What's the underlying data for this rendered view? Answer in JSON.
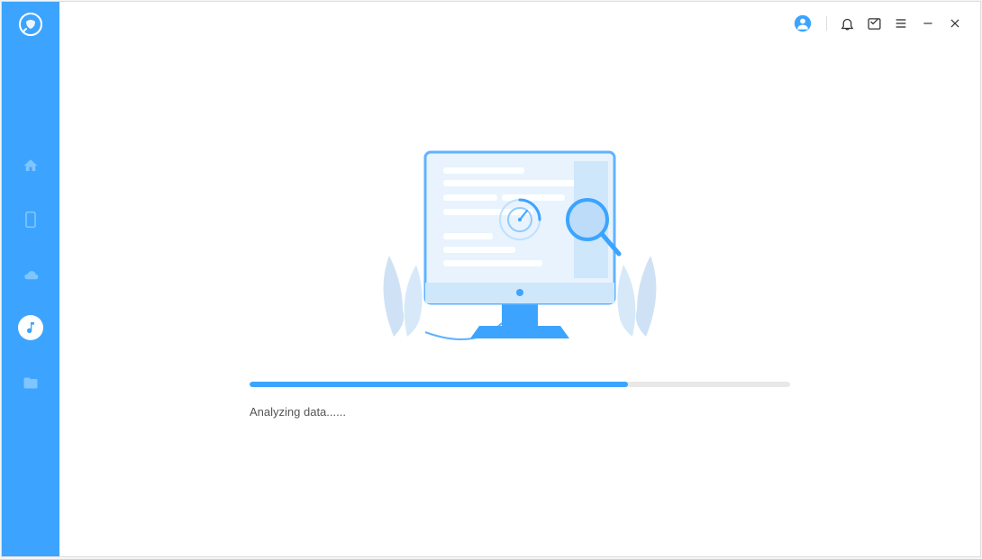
{
  "sidebar": {
    "items": [
      {
        "name": "home"
      },
      {
        "name": "phone"
      },
      {
        "name": "cloud"
      },
      {
        "name": "music",
        "active": true
      },
      {
        "name": "folder"
      }
    ]
  },
  "titlebar": {
    "icons": [
      "account",
      "bell",
      "feedback",
      "menu",
      "minimize",
      "close"
    ]
  },
  "progress": {
    "percent": 70,
    "status_label": "Analyzing data......"
  },
  "colors": {
    "primary": "#3ca4ff",
    "light_blue": "#cfe7fb",
    "lighter_blue": "#e8f3fd",
    "pale_blue": "#d7e9f9"
  }
}
